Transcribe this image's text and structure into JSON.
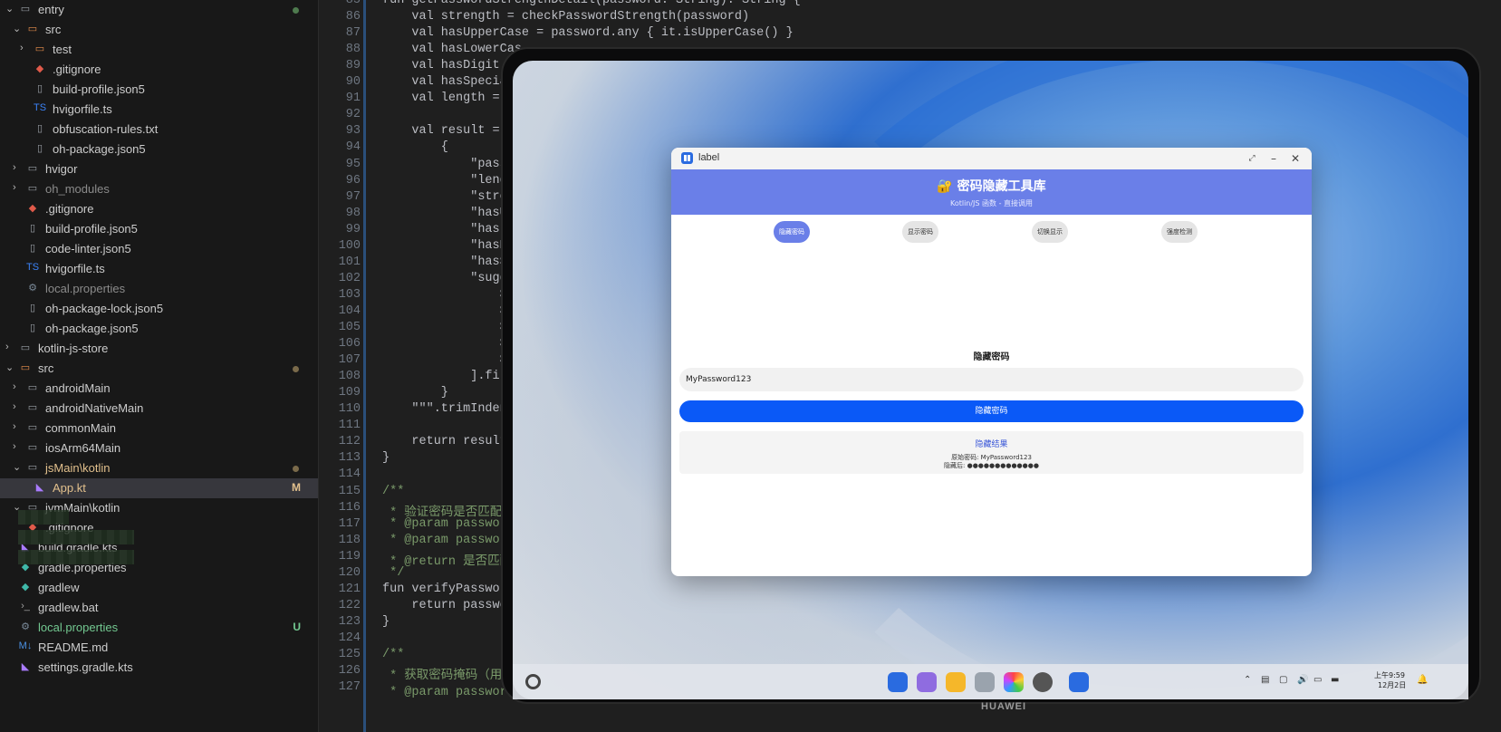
{
  "explorer": {
    "items": [
      {
        "label": "entry",
        "kind": "folder",
        "expanded": true,
        "status": "dot-green"
      },
      {
        "label": "src",
        "kind": "folder-src",
        "expanded": true
      },
      {
        "label": "test",
        "kind": "folder-src",
        "expanded": false
      },
      {
        "label": ".gitignore",
        "kind": "git"
      },
      {
        "label": "build-profile.json5",
        "kind": "file"
      },
      {
        "label": "hvigorfile.ts",
        "kind": "ts"
      },
      {
        "label": "obfuscation-rules.txt",
        "kind": "file"
      },
      {
        "label": "oh-package.json5",
        "kind": "file"
      },
      {
        "label": "hvigor",
        "kind": "folder",
        "expanded": false
      },
      {
        "label": "oh_modules",
        "kind": "folder",
        "expanded": false,
        "dim": true
      },
      {
        "label": ".gitignore",
        "kind": "git"
      },
      {
        "label": "build-profile.json5",
        "kind": "file"
      },
      {
        "label": "code-linter.json5",
        "kind": "file"
      },
      {
        "label": "hvigorfile.ts",
        "kind": "ts"
      },
      {
        "label": "local.properties",
        "kind": "gear",
        "dim": true
      },
      {
        "label": "oh-package-lock.json5",
        "kind": "file"
      },
      {
        "label": "oh-package.json5",
        "kind": "file"
      },
      {
        "label": "kotlin-js-store",
        "kind": "folder",
        "expanded": false
      },
      {
        "label": "src",
        "kind": "folder-src",
        "expanded": true,
        "status": "dot"
      },
      {
        "label": "androidMain",
        "kind": "folder",
        "expanded": false
      },
      {
        "label": "androidNativeMain",
        "kind": "folder",
        "expanded": false
      },
      {
        "label": "commonMain",
        "kind": "folder",
        "expanded": false
      },
      {
        "label": "iosArm64Main",
        "kind": "folder",
        "expanded": false
      },
      {
        "label": "jsMain\\kotlin",
        "kind": "folder",
        "expanded": true,
        "accent": true,
        "status": "dot"
      },
      {
        "label": "App.kt",
        "kind": "kotlin",
        "accent": true,
        "selected": true,
        "status": "M"
      },
      {
        "label": "jvmMain\\kotlin",
        "kind": "folder",
        "expanded": true
      },
      {
        "label": ".gitignore",
        "kind": "git"
      },
      {
        "label": "build.gradle.kts",
        "kind": "kotlin"
      },
      {
        "label": "gradle.properties",
        "kind": "gradle"
      },
      {
        "label": "gradlew",
        "kind": "gradle"
      },
      {
        "label": "gradlew.bat",
        "kind": "term"
      },
      {
        "label": "local.properties",
        "kind": "gear",
        "green": true,
        "status": "U"
      },
      {
        "label": "README.md",
        "kind": "md"
      },
      {
        "label": "settings.gradle.kts",
        "kind": "kotlin"
      }
    ]
  },
  "editor": {
    "lines": [
      {
        "n": "85",
        "t": "fun getPasswordStrengthDetail(password: String): String {"
      },
      {
        "n": "86",
        "t": "    val strength = checkPasswordStrength(password)"
      },
      {
        "n": "87",
        "t": "    val hasUpperCase = password.any { it.isUpperCase() }"
      },
      {
        "n": "88",
        "t": "    val hasLowerCas"
      },
      {
        "n": "89",
        "t": "    val hasDigit"
      },
      {
        "n": "90",
        "t": "    val hasSpecia"
      },
      {
        "n": "91",
        "t": "    val length ="
      },
      {
        "n": "92",
        "t": ""
      },
      {
        "n": "93",
        "t": "    val result ="
      },
      {
        "n": "94",
        "t": "        {"
      },
      {
        "n": "95",
        "t": "            \"pass"
      },
      {
        "n": "96",
        "t": "            \"leng"
      },
      {
        "n": "97",
        "t": "            \"stre"
      },
      {
        "n": "98",
        "t": "            \"hasU"
      },
      {
        "n": "99",
        "t": "            \"hasL"
      },
      {
        "n": "100",
        "t": "            \"hasD"
      },
      {
        "n": "101",
        "t": "            \"hasS"
      },
      {
        "n": "102",
        "t": "            \"sugg"
      },
      {
        "n": "103",
        "t": "                $"
      },
      {
        "n": "104",
        "t": "                $"
      },
      {
        "n": "105",
        "t": "                $"
      },
      {
        "n": "106",
        "t": "                $"
      },
      {
        "n": "107",
        "t": "                $"
      },
      {
        "n": "108",
        "t": "            ].fil"
      },
      {
        "n": "109",
        "t": "        }"
      },
      {
        "n": "110",
        "t": "    \"\"\".trimIndent"
      },
      {
        "n": "111",
        "t": ""
      },
      {
        "n": "112",
        "t": "    return result"
      },
      {
        "n": "113",
        "t": "}"
      },
      {
        "n": "114",
        "t": ""
      },
      {
        "n": "115",
        "t": "/**"
      },
      {
        "n": "116",
        "t": " * 验证密码是否匹配"
      },
      {
        "n": "117",
        "t": " * @param passwor"
      },
      {
        "n": "118",
        "t": " * @param passwor"
      },
      {
        "n": "119",
        "t": " * @return 是否匹配"
      },
      {
        "n": "120",
        "t": " */"
      },
      {
        "n": "121",
        "t": "fun verifyPasswor"
      },
      {
        "n": "122",
        "t": "    return passwo"
      },
      {
        "n": "123",
        "t": "}"
      },
      {
        "n": "124",
        "t": ""
      },
      {
        "n": "125",
        "t": "/**"
      },
      {
        "n": "126",
        "t": " * 获取密码掩码（用"
      },
      {
        "n": "127",
        "t": " * @param password 原始密码"
      }
    ]
  },
  "app": {
    "window_title": "label",
    "banner_title": "🔐 密码隐藏工具库",
    "banner_subtitle": "Kotlin/JS 函数 - 直接调用",
    "tabs": [
      "隐藏密码",
      "显示密码",
      "切换显示",
      "强度检测"
    ],
    "active_tab": 0,
    "section_title": "隐藏密码",
    "password_value": "MyPassword123",
    "hide_button": "隐藏密码",
    "result_title": "隐藏结果",
    "result_original": "原始密码: MyPassword123",
    "result_masked": "隐藏后: ●●●●●●●●●●●●●",
    "accent": "#6a7fe8",
    "primary": "#0a59f7"
  },
  "taskbar": {
    "time": "上午9:59",
    "date": "12月2日",
    "apps": [
      "app-grid",
      "files-board",
      "folder",
      "trash",
      "gallery",
      "settings",
      "label-app"
    ]
  },
  "device_brand": "HUAWEI"
}
